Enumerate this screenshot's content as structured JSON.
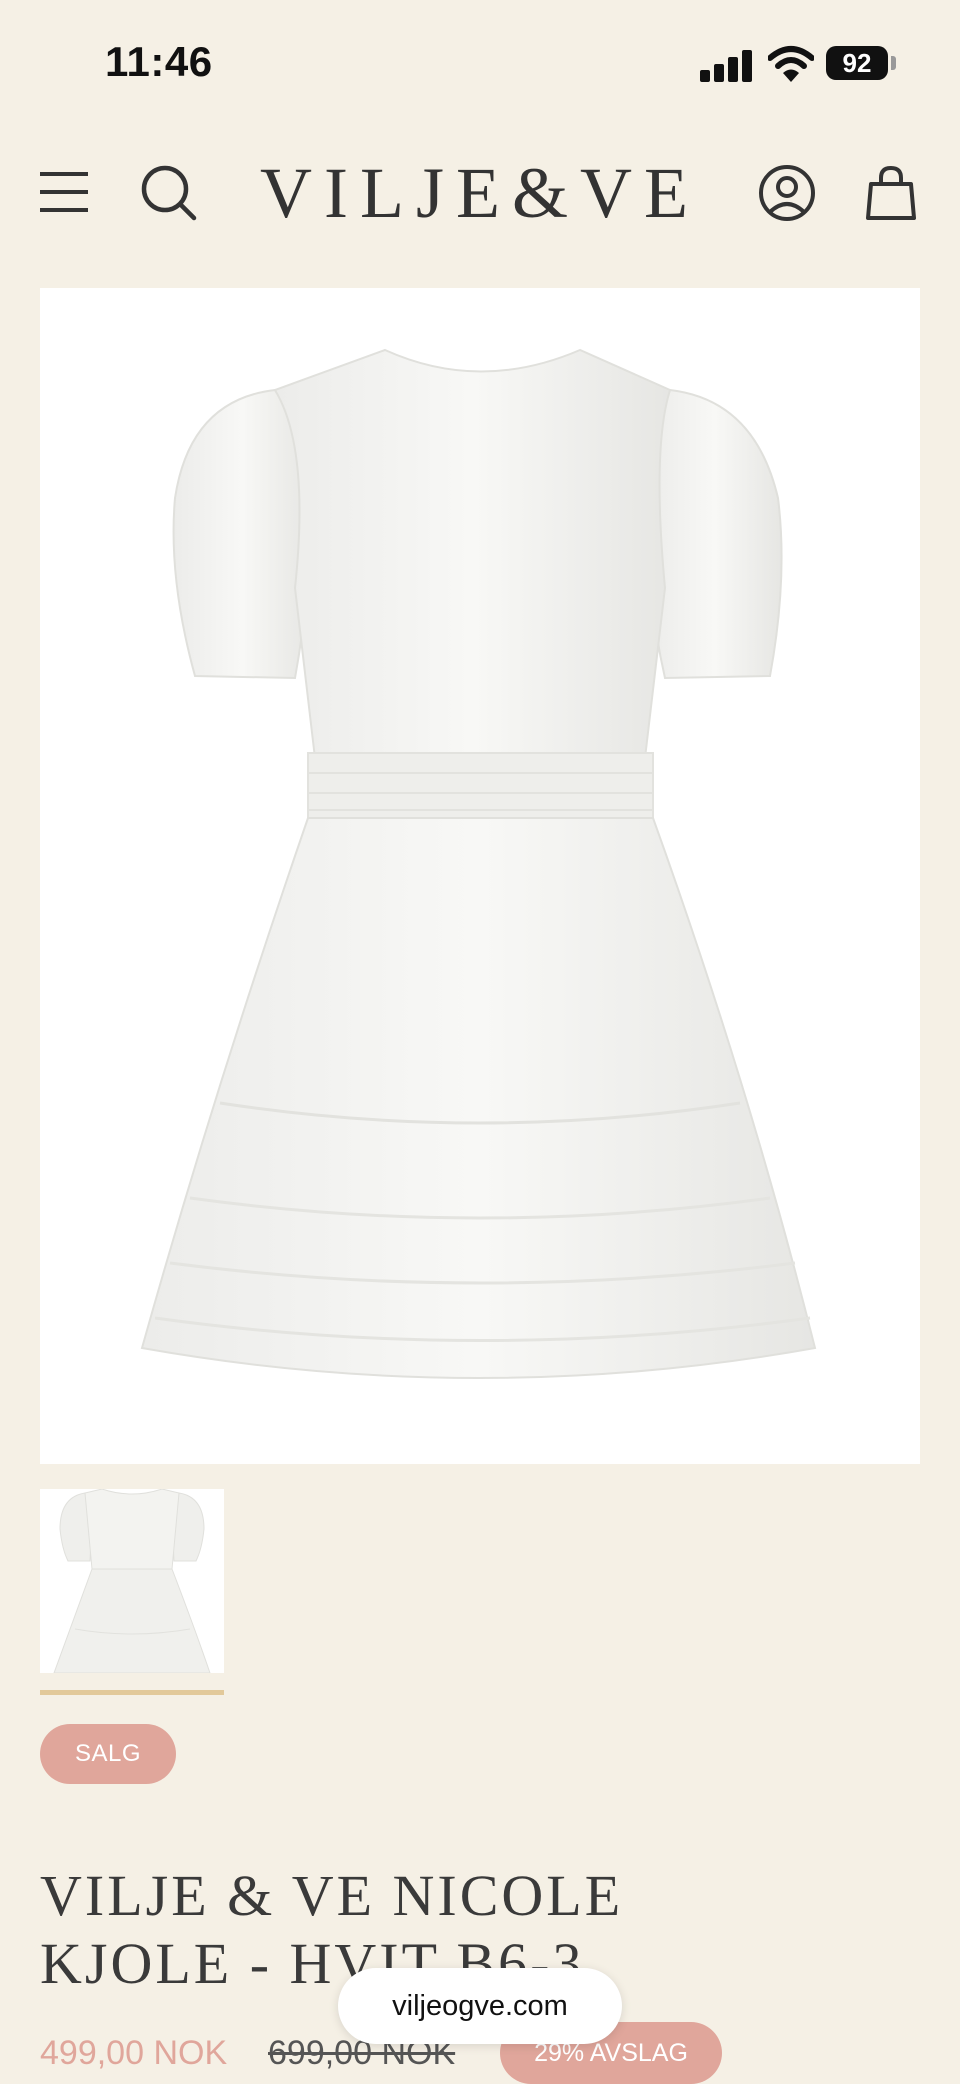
{
  "status_bar": {
    "time": "11:46",
    "battery": "92"
  },
  "header": {
    "logo": "VILJE&VE",
    "icons": [
      "menu-icon",
      "search-icon",
      "account-icon",
      "cart-icon"
    ]
  },
  "product": {
    "badge_sale": "SALG",
    "title_line1": "VILJE & VE NICOLE",
    "title_line2": "KJOLE - HVIT B6-3",
    "price_current": "499,00 NOK",
    "price_original": "699,00 NOK",
    "discount_badge": "29% AVSLAG"
  },
  "browser": {
    "url": "viljeogve.com"
  },
  "colors": {
    "background": "#f5f0e5",
    "accent": "#e0a69b",
    "thumb_indicator": "#e2c99a",
    "text": "#3a3a3a"
  }
}
